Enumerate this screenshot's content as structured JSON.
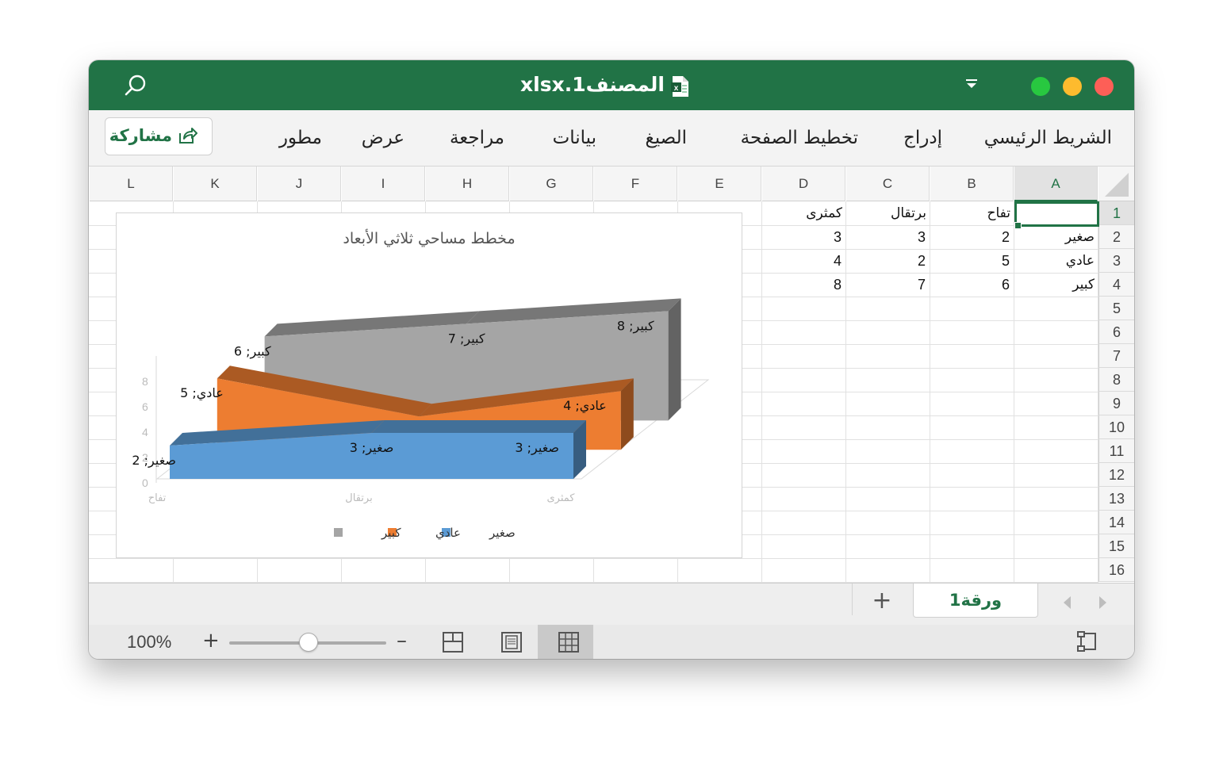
{
  "window": {
    "title": "المصنف1.xlsx"
  },
  "ribbon": {
    "tabs": [
      "الشريط الرئيسي",
      "إدراج",
      "تخطيط الصفحة",
      "الصيغ",
      "بيانات",
      "مراجعة",
      "عرض",
      "مطور"
    ],
    "share_label": "مشاركة"
  },
  "grid": {
    "columns": [
      "A",
      "B",
      "C",
      "D",
      "E",
      "F",
      "G",
      "H",
      "I",
      "J",
      "K",
      "L"
    ],
    "rows": [
      "1",
      "2",
      "3",
      "4",
      "5",
      "6",
      "7",
      "8",
      "9",
      "10",
      "11",
      "12",
      "13",
      "14",
      "15",
      "16"
    ],
    "active_cell": "A1",
    "cells": {
      "B1": "تفاح",
      "C1": "برتقال",
      "D1": "كمثرى",
      "A2": "صغير",
      "B2": "2",
      "C2": "3",
      "D2": "3",
      "A3": "عادي",
      "B3": "5",
      "C3": "2",
      "D3": "4",
      "A4": "كبير",
      "B4": "6",
      "C4": "7",
      "D4": "8"
    }
  },
  "chart_data": {
    "type": "area",
    "subtype": "3d-area",
    "title": "مخطط مساحي ثلاثي الأبعاد",
    "categories": [
      "تفاح",
      "برتقال",
      "كمثرى"
    ],
    "series": [
      {
        "name": "صغير",
        "values": [
          2,
          3,
          3
        ],
        "color": "#5b9bd5"
      },
      {
        "name": "عادي",
        "values": [
          5,
          2,
          4
        ],
        "color": "#ed7d31"
      },
      {
        "name": "كبير",
        "values": [
          6,
          7,
          8
        ],
        "color": "#a5a5a5"
      }
    ],
    "y_ticks": [
      "0",
      "2",
      "4",
      "6",
      "8"
    ],
    "ylim": [
      0,
      8
    ],
    "legend_position": "bottom",
    "data_label_separator": "; "
  },
  "sheets": {
    "tabs": [
      "ورقة1"
    ],
    "active": "ورقة1"
  },
  "status": {
    "zoom": "100%"
  }
}
